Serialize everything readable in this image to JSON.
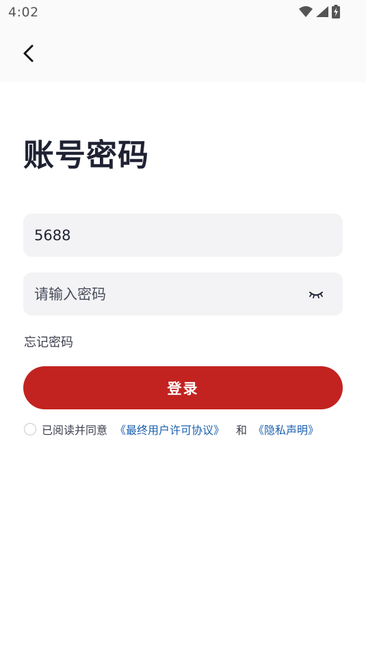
{
  "status_bar": {
    "time": "4:02",
    "icons": [
      "wifi-icon",
      "signal-icon",
      "battery-charging-icon"
    ]
  },
  "nav": {
    "back_icon": "chevron-left-icon"
  },
  "title": "账号密码",
  "account_field": {
    "value": "5688"
  },
  "password_field": {
    "placeholder": "请输入密码",
    "toggle_icon": "eye-closed-icon"
  },
  "forgot_password": "忘记密码",
  "login_button": "登录",
  "agreement": {
    "prefix": "已阅读并同意",
    "eula_link": "《最终用户许可协议》",
    "conjunction": "和",
    "privacy_link": "《隐私声明》"
  },
  "colors": {
    "primary": "#c22320",
    "link": "#1b5fae",
    "field_bg": "#f3f3f5",
    "title_text": "#1f2233"
  }
}
